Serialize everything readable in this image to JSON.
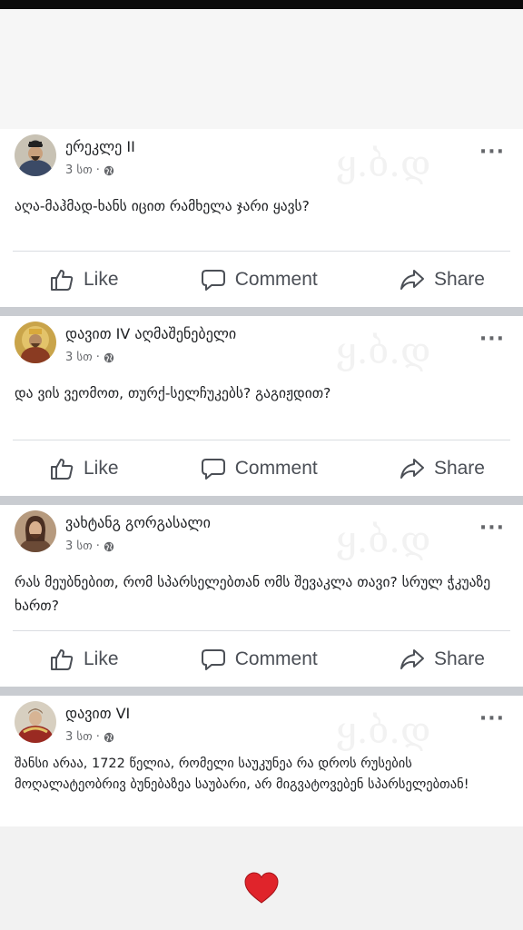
{
  "posts": [
    {
      "author": "ერეკლე II",
      "time": "3 სთ ·",
      "text": "აღა-მაჰმად-ხანს იცით რამხელა ჯარი ყავს?",
      "watermark": "ყ.ბ.დ",
      "actions": {
        "like": "Like",
        "comment": "Comment",
        "share": "Share"
      }
    },
    {
      "author": "დავით IV აღმაშენებელი",
      "time": "3 სთ ·",
      "text": "და ვის ვეომოთ, თურქ-სელჩუკებს? გაგიჟდით?",
      "watermark": "ყ.ბ.დ",
      "actions": {
        "like": "Like",
        "comment": "Comment",
        "share": "Share"
      }
    },
    {
      "author": "ვახტანგ გორგასალი",
      "time": "3 სთ ·",
      "text": "რას მეუბნებით, რომ სპარსელებთან ომს შევაკლა თავი? სრულ ჭკუაზე ხართ?",
      "watermark": "ყ.ბ.დ",
      "actions": {
        "like": "Like",
        "comment": "Comment",
        "share": "Share"
      }
    },
    {
      "author": "დავით VI",
      "time": "3 სთ ·",
      "text": "შანსი არაა, 1722 წელია, რომელი საუკუნეა რა დროს რუსების მოღალატეობრივ ბუნებაზეა საუბარი, არ მიგვატოვებენ სპარსელებთან!",
      "watermark": "ყ.ბ.დ"
    }
  ],
  "colors": {
    "reaction_heart": "#e0242b",
    "separator": "#c9ccd1"
  },
  "icons": [
    "thumbs-up-icon",
    "comment-icon",
    "share-icon",
    "globe-icon",
    "more-icon",
    "heart-icon"
  ]
}
